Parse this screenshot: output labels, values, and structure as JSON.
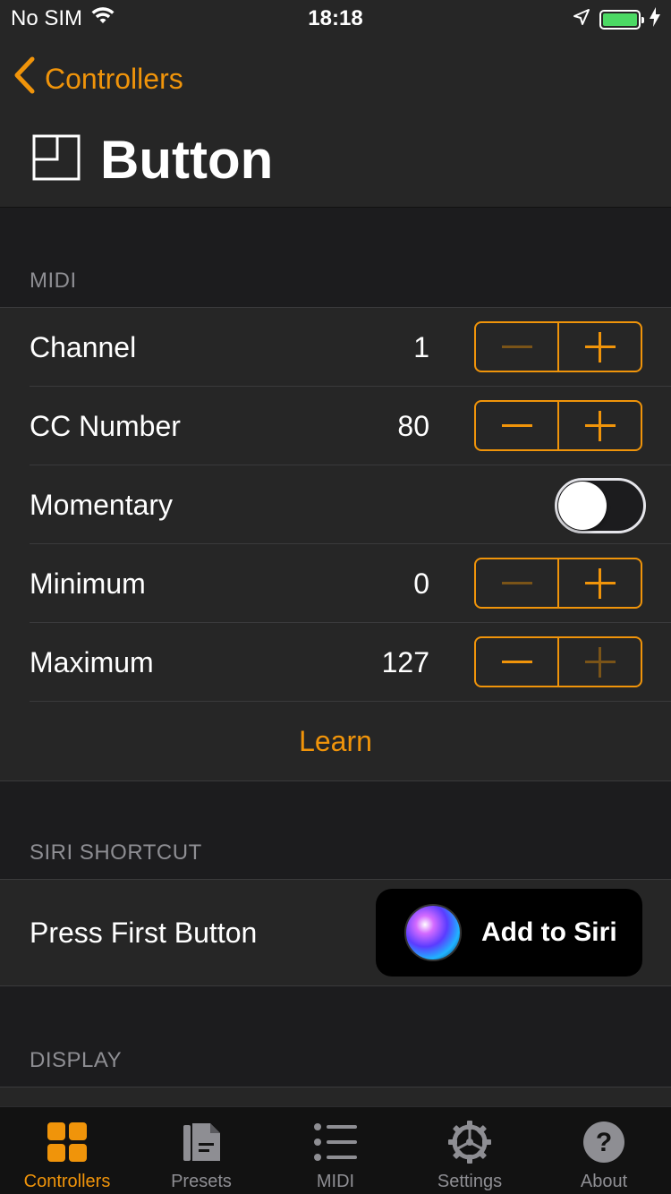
{
  "status_bar": {
    "carrier": "No SIM",
    "time": "18:18",
    "battery_level": 1.0
  },
  "nav": {
    "back_label": "Controllers",
    "title": "Button"
  },
  "sections": {
    "midi": {
      "header": "MIDI",
      "rows": [
        {
          "label": "Channel",
          "value": "1"
        },
        {
          "label": "CC Number",
          "value": "80"
        },
        {
          "label": "Momentary",
          "toggle_on": false
        },
        {
          "label": "Minimum",
          "value": "0"
        },
        {
          "label": "Maximum",
          "value": "127"
        }
      ],
      "learn_label": "Learn"
    },
    "siri": {
      "header": "SIRI SHORTCUT",
      "row_label": "Press First Button",
      "button_label": "Add to Siri"
    },
    "display": {
      "header": "DISPLAY"
    }
  },
  "tab_bar": {
    "tabs": [
      {
        "label": "Controllers",
        "icon": "grid-icon",
        "active": true
      },
      {
        "label": "Presets",
        "icon": "document-icon",
        "active": false
      },
      {
        "label": "MIDI",
        "icon": "list-icon",
        "active": false
      },
      {
        "label": "Settings",
        "icon": "gear-icon",
        "active": false
      },
      {
        "label": "About",
        "icon": "question-icon",
        "active": false
      }
    ]
  },
  "colors": {
    "accent": "#f0940a",
    "background": "#1c1c1e",
    "cell_background": "#262626",
    "secondary_text": "#8e8e93"
  }
}
